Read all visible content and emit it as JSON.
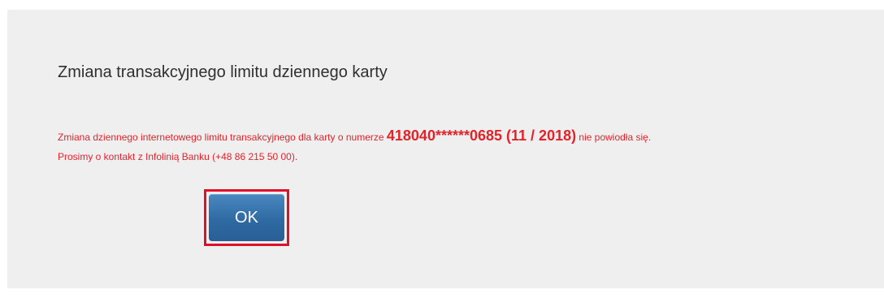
{
  "dialog": {
    "title": "Zmiana transakcyjnego limitu dziennego karty",
    "message": {
      "part1": "Zmiana dziennego internetowego limitu transakcyjnego dla karty o numerze ",
      "card_number": "418040******0685 (11 / 2018)",
      "part2": " nie powiodła się.",
      "line2": "Prosimy o kontakt z Infolinią Banku (+48 86 215 50 00)."
    },
    "ok_label": "OK"
  },
  "colors": {
    "panel_bg": "#efefef",
    "error_text": "#e2232a",
    "button_bg": "#2f6aa3",
    "highlight_border": "#e0102a"
  }
}
